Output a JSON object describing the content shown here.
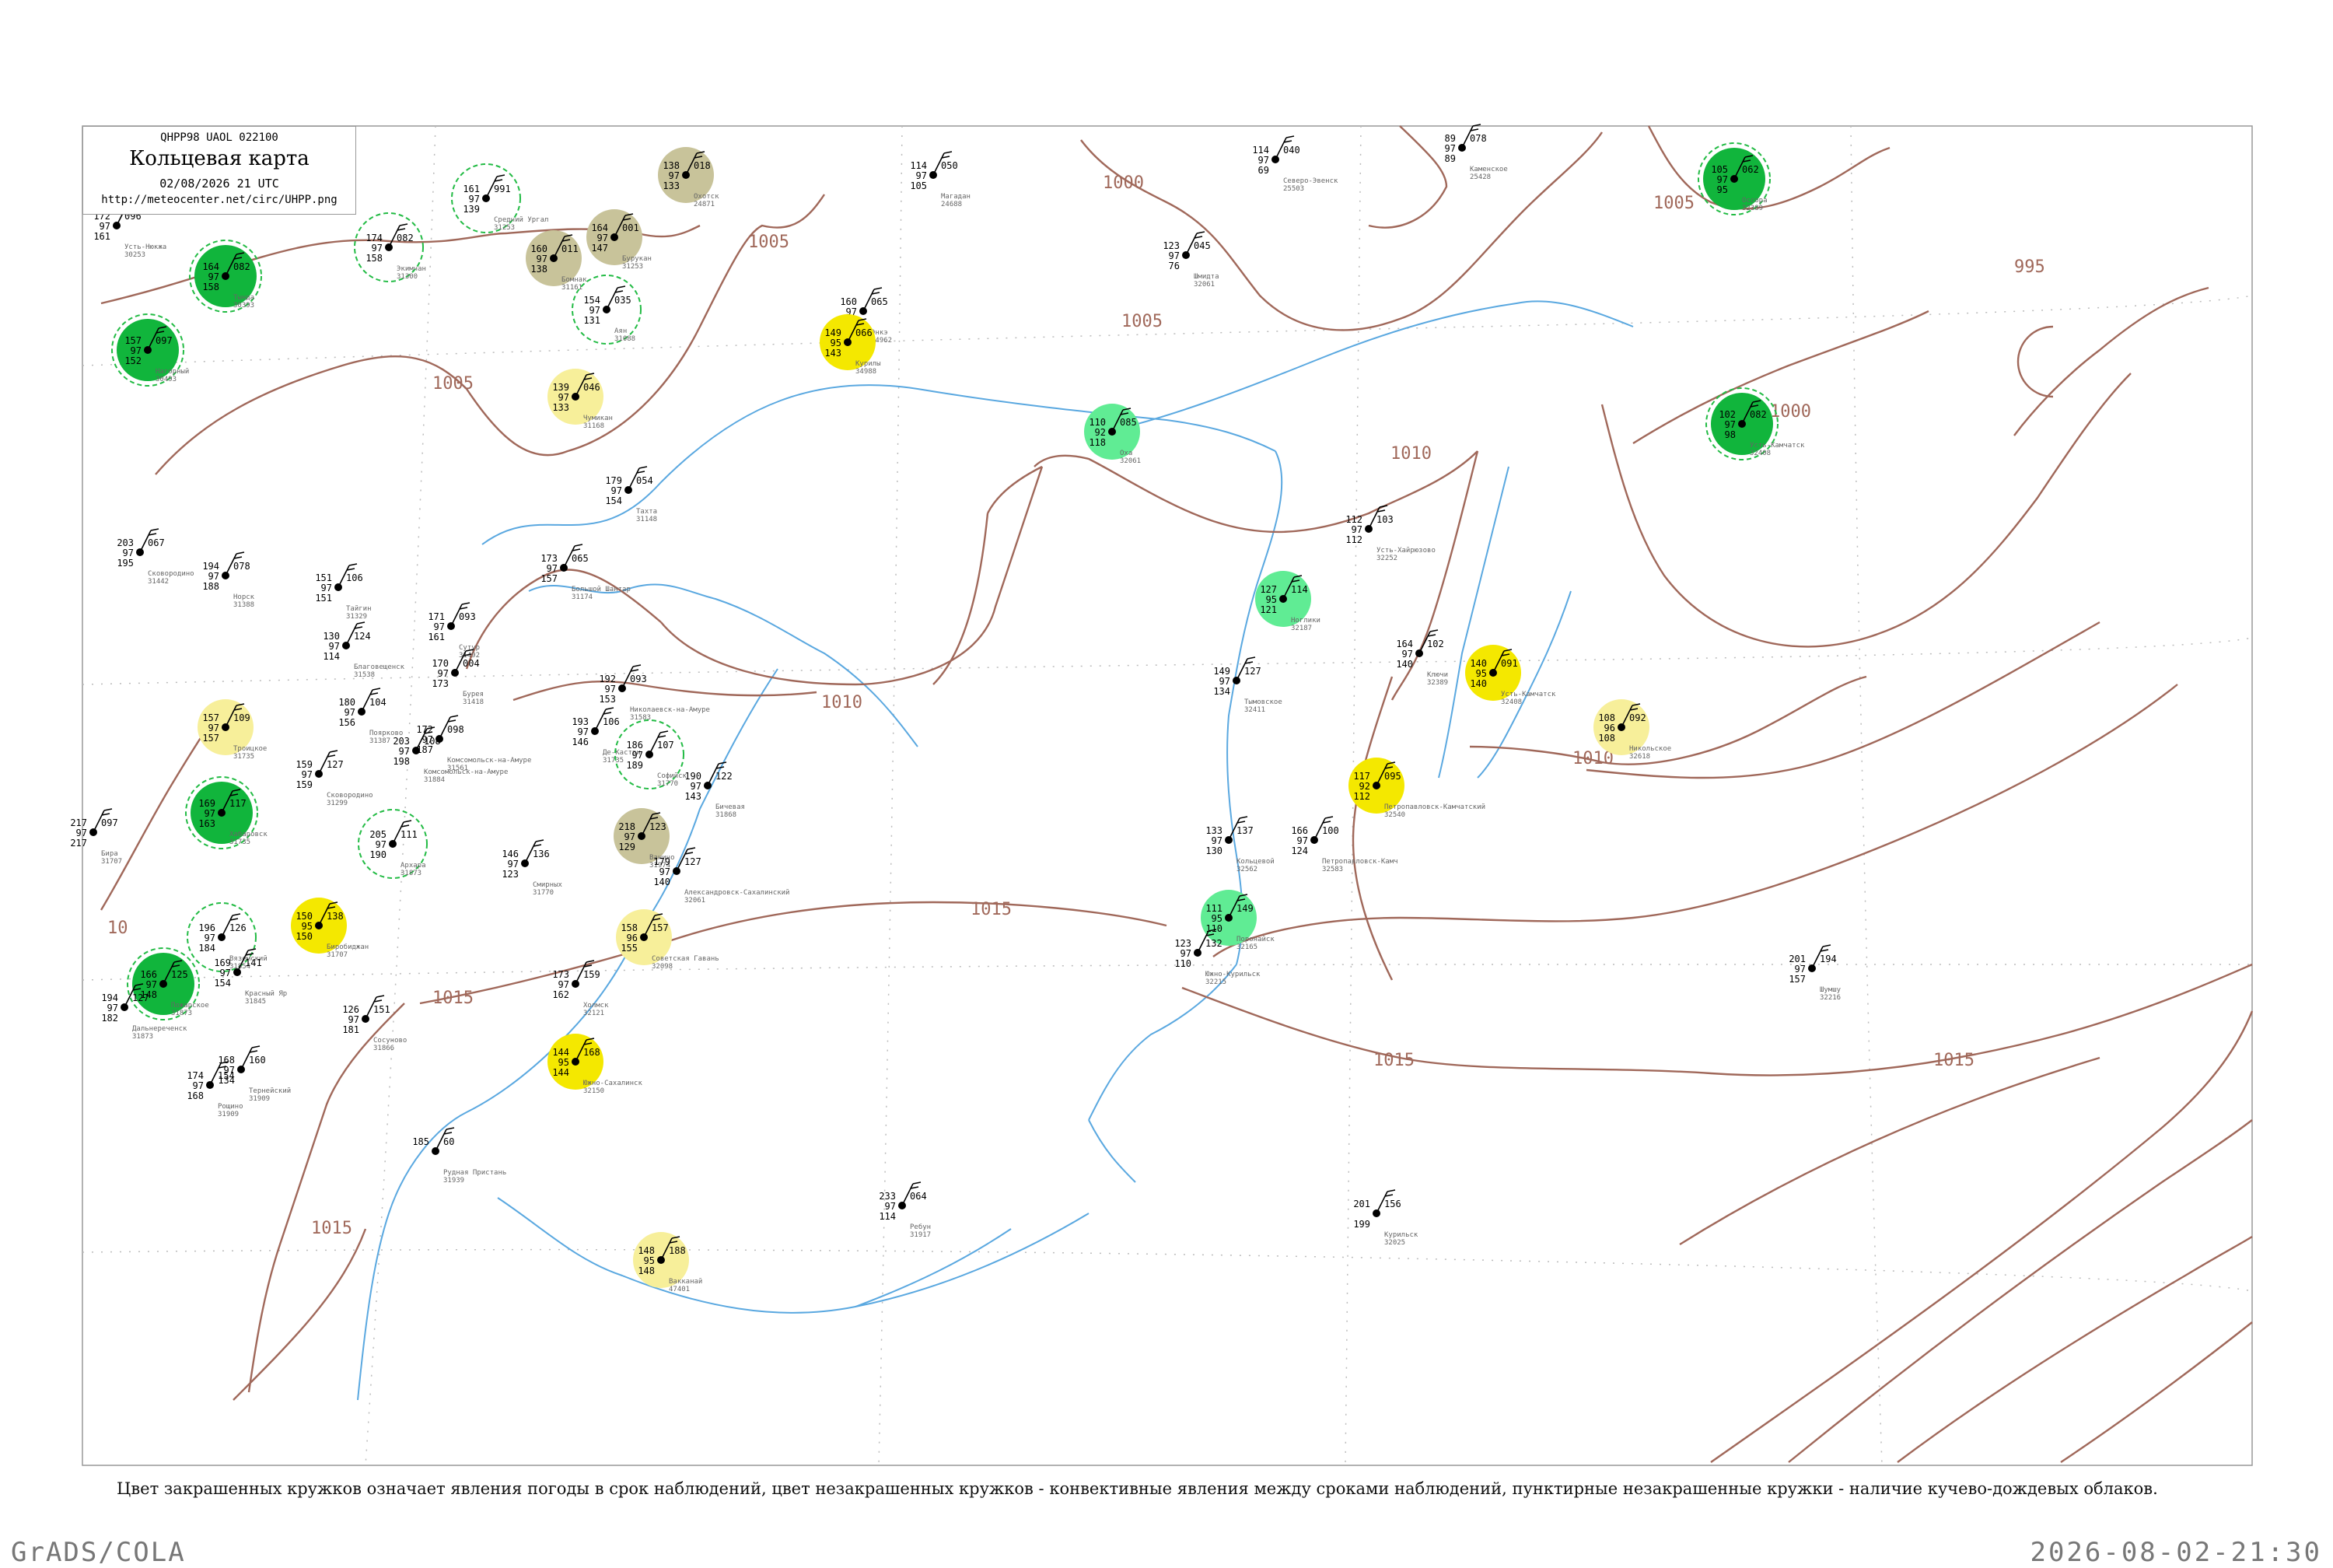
{
  "header": {
    "code": "QHPP98  UAOL  022100",
    "title": "Кольцевая карта",
    "datetime": "02/08/2026 21 UTC",
    "url": "http://meteocenter.net/circ/UHPP.png"
  },
  "caption": "Цвет закрашенных кружков означает явления погоды в срок наблюдений, цвет незакрашенных кружков - конвективные явления между сроками наблюдений, пунктирные незакрашенные кружки - наличие кучево-дождевых облаков.",
  "footer": {
    "left": "GrADS/COLA",
    "right": "2026-08-02-21:30"
  },
  "colors": {
    "isobar": "#a0685a",
    "river": "#5aa8e0",
    "frame": "#999999",
    "shower_dark": "#11b53c",
    "rain_light": "#60ec94",
    "drizzle_yellow": "#f4e800",
    "pale_yellow": "#f7ef9a",
    "fog_olive": "#c8c39a",
    "cb_dashed": "#22bb44"
  },
  "isobar_labels": [
    "1000",
    "1005",
    "1005",
    "1005",
    "1005",
    "995",
    "1000",
    "1010",
    "1010",
    "1010",
    "1015",
    "1015",
    "1015",
    "1015",
    "1015",
    "10"
  ],
  "stations": [
    {
      "name": "Усть-Нюкжа",
      "id": "30253",
      "t": "172",
      "p": "096",
      "v": "97",
      "td": "161",
      "kind": "none"
    },
    {
      "name": "Тында",
      "id": "30393",
      "t": "164",
      "p": "082",
      "v": "97",
      "td": "158",
      "kind": "dark"
    },
    {
      "name": "Нагорный",
      "id": "30493",
      "t": "157",
      "p": "097",
      "v": "97",
      "td": "152",
      "kind": "dark"
    },
    {
      "name": "Средний Ургал",
      "id": "31253",
      "t": "161",
      "p": "991",
      "v": "97",
      "td": "139",
      "kind": "cb"
    },
    {
      "name": "Экимчан",
      "id": "31300",
      "t": "174",
      "p": "082",
      "v": "97",
      "td": "158",
      "kind": "cb"
    },
    {
      "name": "Бомнак",
      "id": "31161",
      "t": "160",
      "p": "011",
      "v": "97",
      "td": "138",
      "kind": "olive"
    },
    {
      "name": "Бурукан",
      "id": "31253",
      "t": "164",
      "p": "001",
      "v": "97",
      "td": "147",
      "kind": "olive"
    },
    {
      "name": "Аян",
      "id": "31088",
      "t": "154",
      "p": "035",
      "v": "97",
      "td": "131",
      "kind": "cb"
    },
    {
      "name": "Чумикан",
      "id": "31168",
      "t": "139",
      "p": "046",
      "v": "97",
      "td": "133",
      "kind": "pale"
    },
    {
      "name": "Охотск",
      "id": "24871",
      "t": "138",
      "p": "018",
      "v": "97",
      "td": "133",
      "kind": "olive"
    },
    {
      "name": "Магадан",
      "id": "24688",
      "t": "114",
      "p": "050",
      "v": "97",
      "td": "105",
      "kind": "none"
    },
    {
      "name": "Северо-Эвенск",
      "id": "25503",
      "t": "114",
      "p": "040",
      "v": "97",
      "td": "69",
      "kind": "none"
    },
    {
      "name": "Каменское",
      "id": "25428",
      "t": "89",
      "p": "078",
      "v": "97",
      "td": "89",
      "kind": "none"
    },
    {
      "name": "Оссора",
      "id": "32389",
      "t": "105",
      "p": "062",
      "v": "97",
      "td": "95",
      "kind": "dark"
    },
    {
      "name": "Усть-Камчатск",
      "id": "32408",
      "t": "102",
      "p": "082",
      "v": "97",
      "td": "98",
      "kind": "dark"
    },
    {
      "name": "Шмидта",
      "id": "32061",
      "t": "123",
      "p": "045",
      "v": "97",
      "td": "76",
      "kind": "none"
    },
    {
      "name": "Энкэ",
      "id": "34962",
      "t": "160",
      "p": "065",
      "v": "97",
      "td": "65",
      "kind": "none"
    },
    {
      "name": "Курилы",
      "id": "34988",
      "t": "149",
      "p": "066",
      "v": "95",
      "td": "143",
      "kind": "yellow"
    },
    {
      "name": "Оха",
      "id": "32061",
      "t": "110",
      "p": "085",
      "v": "92",
      "td": "118",
      "kind": "light"
    },
    {
      "name": "Тахта",
      "id": "31148",
      "t": "179",
      "p": "054",
      "v": "97",
      "td": "154",
      "kind": "none"
    },
    {
      "name": "Большой Шантар",
      "id": "31174",
      "t": "173",
      "p": "065",
      "v": "97",
      "td": "157",
      "kind": "none"
    },
    {
      "name": "Усть-Хайрюзово",
      "id": "32252",
      "t": "112",
      "p": "103",
      "v": "97",
      "td": "112",
      "kind": "none"
    },
    {
      "name": "Ноглики",
      "id": "32187",
      "t": "127",
      "p": "114",
      "v": "95",
      "td": "121",
      "kind": "light"
    },
    {
      "name": "Ключи",
      "id": "32389",
      "t": "164",
      "p": "102",
      "v": "97",
      "td": "140",
      "kind": "none"
    },
    {
      "name": "Усть-Камчатск",
      "id": "32408",
      "t": "140",
      "p": "091",
      "v": "95",
      "td": "140",
      "kind": "yellow"
    },
    {
      "name": "Никольское",
      "id": "32618",
      "t": "108",
      "p": "092",
      "v": "96",
      "td": "108",
      "kind": "pale"
    },
    {
      "name": "Тымовское",
      "id": "32411",
      "t": "149",
      "p": "127",
      "v": "97",
      "td": "134",
      "kind": "none"
    },
    {
      "name": "Петропавловск-Камчатский",
      "id": "32540",
      "t": "117",
      "p": "095",
      "v": "92",
      "td": "112",
      "kind": "yellow"
    },
    {
      "name": "Кольцевой",
      "id": "32562",
      "t": "133",
      "p": "137",
      "v": "97",
      "td": "130",
      "kind": "none"
    },
    {
      "name": "Петропавловск-Камч",
      "id": "32583",
      "t": "166",
      "p": "100",
      "v": "97",
      "td": "124",
      "kind": "none"
    },
    {
      "name": "Поронайск",
      "id": "32165",
      "t": "111",
      "p": "149",
      "v": "95",
      "td": "110",
      "kind": "light"
    },
    {
      "name": "Южно-Курильск",
      "id": "32215",
      "t": "123",
      "p": "132",
      "v": "97",
      "td": "110",
      "kind": "none"
    },
    {
      "name": "Шумшу",
      "id": "32216",
      "t": "201",
      "p": "194",
      "v": "97",
      "td": "157",
      "kind": "none"
    },
    {
      "name": "Сковородино",
      "id": "31442",
      "t": "203",
      "p": "067",
      "v": "97",
      "td": "195",
      "kind": "none"
    },
    {
      "name": "Норск",
      "id": "31388",
      "t": "194",
      "p": "078",
      "v": "97",
      "td": "188",
      "kind": "none"
    },
    {
      "name": "Тайгин",
      "id": "31329",
      "t": "151",
      "p": "106",
      "v": "97",
      "td": "151",
      "kind": "none"
    },
    {
      "name": "Благовещенск",
      "id": "31538",
      "t": "130",
      "p": "124",
      "v": "97",
      "td": "114",
      "kind": "none"
    },
    {
      "name": "Сутур",
      "id": "31492",
      "t": "171",
      "p": "093",
      "v": "97",
      "td": "161",
      "kind": "none"
    },
    {
      "name": "Бурея",
      "id": "31418",
      "t": "170",
      "p": "004",
      "v": "97",
      "td": "173",
      "kind": "none"
    },
    {
      "name": "Николаевск-на-Амуре",
      "id": "31583",
      "t": "192",
      "p": "093",
      "v": "97",
      "td": "153",
      "kind": "none"
    },
    {
      "name": "Де-Кастри",
      "id": "31735",
      "t": "193",
      "p": "106",
      "v": "97",
      "td": "146",
      "kind": "none"
    },
    {
      "name": "Софийск",
      "id": "31770",
      "t": "186",
      "p": "107",
      "v": "97",
      "td": "189",
      "kind": "cb"
    },
    {
      "name": "Бичевая",
      "id": "31868",
      "t": "190",
      "p": "122",
      "v": "97",
      "td": "143",
      "kind": "none"
    },
    {
      "name": "Комсомольск-на-Амуре",
      "id": "31561",
      "t": "172",
      "p": "098",
      "v": "97",
      "td": "187",
      "kind": "none"
    },
    {
      "name": "Комсомольск-на-Амуре",
      "id": "31884",
      "t": "203",
      "p": "108",
      "v": "97",
      "td": "198",
      "kind": "none"
    },
    {
      "name": "Поярково",
      "id": "31387",
      "t": "180",
      "p": "104",
      "v": "97",
      "td": "156",
      "kind": "none"
    },
    {
      "name": "Сковородино",
      "id": "31299",
      "t": "159",
      "p": "127",
      "v": "97",
      "td": "159",
      "kind": "none"
    },
    {
      "name": "Архара",
      "id": "31873",
      "t": "205",
      "p": "111",
      "v": "97",
      "td": "190",
      "kind": "cb"
    },
    {
      "name": "Ванино",
      "id": "31974",
      "t": "218",
      "p": "123",
      "v": "97",
      "td": "129",
      "kind": "olive"
    },
    {
      "name": "Александровск-Сахалинский",
      "id": "32061",
      "t": "179",
      "p": "127",
      "v": "97",
      "td": "140",
      "kind": "none"
    },
    {
      "name": "Смирных",
      "id": "31770",
      "t": "146",
      "p": "136",
      "v": "97",
      "td": "123",
      "kind": "none"
    },
    {
      "name": "Советская Гавань",
      "id": "32098",
      "t": "158",
      "p": "157",
      "v": "96",
      "td": "155",
      "kind": "pale"
    },
    {
      "name": "Троицкое",
      "id": "31735",
      "t": "157",
      "p": "109",
      "v": "97",
      "td": "157",
      "kind": "pale"
    },
    {
      "name": "Хабаровск",
      "id": "31735",
      "t": "169",
      "p": "117",
      "v": "97",
      "td": "163",
      "kind": "dark"
    },
    {
      "name": "Бира",
      "id": "31707",
      "t": "217",
      "p": "097",
      "v": "97",
      "td": "217",
      "kind": "none"
    },
    {
      "name": "Биробиджан",
      "id": "31707",
      "t": "150",
      "p": "138",
      "v": "95",
      "td": "150",
      "kind": "yellow"
    },
    {
      "name": "Вяземский",
      "id": "31854",
      "t": "196",
      "p": "126",
      "v": "97",
      "td": "184",
      "kind": "cb"
    },
    {
      "name": "Пожарское",
      "id": "31873",
      "t": "166",
      "p": "125",
      "v": "97",
      "td": "148",
      "kind": "dark"
    },
    {
      "name": "Дальнереченск",
      "id": "31873",
      "t": "194",
      "p": "127",
      "v": "97",
      "td": "182",
      "kind": "none"
    },
    {
      "name": "Красный Яр",
      "id": "31845",
      "t": "169",
      "p": "141",
      "v": "97",
      "td": "154",
      "kind": "none"
    },
    {
      "name": "Сосуново",
      "id": "31866",
      "t": "126",
      "p": "151",
      "v": "97",
      "td": "181",
      "kind": "none"
    },
    {
      "name": "Южно-Сахалинск",
      "id": "32150",
      "t": "144",
      "p": "168",
      "v": "95",
      "td": "144",
      "kind": "yellow"
    },
    {
      "name": "Рощино",
      "id": "31909",
      "t": "174",
      "p": "154",
      "v": "97",
      "td": "168",
      "kind": "none"
    },
    {
      "name": "Тернейский",
      "id": "31909",
      "t": "168",
      "p": "160",
      "v": "97",
      "td": "134",
      "kind": "none"
    },
    {
      "name": "Холмск",
      "id": "32121",
      "t": "173",
      "p": "159",
      "v": "97",
      "td": "162",
      "kind": "none"
    },
    {
      "name": "Рудная Пристань",
      "id": "31939",
      "t": "185",
      "p": "60",
      "v": "",
      "td": "",
      "kind": "none"
    },
    {
      "name": "Ребун",
      "id": "31917",
      "t": "233",
      "p": "064",
      "v": "97",
      "td": "114",
      "kind": "none"
    },
    {
      "name": "Вакканай",
      "id": "47401",
      "t": "148",
      "p": "188",
      "v": "95",
      "td": "148",
      "kind": "pale"
    },
    {
      "name": "Курильск",
      "id": "32025",
      "t": "201",
      "p": "156",
      "v": "",
      "td": "199",
      "kind": "none"
    }
  ]
}
